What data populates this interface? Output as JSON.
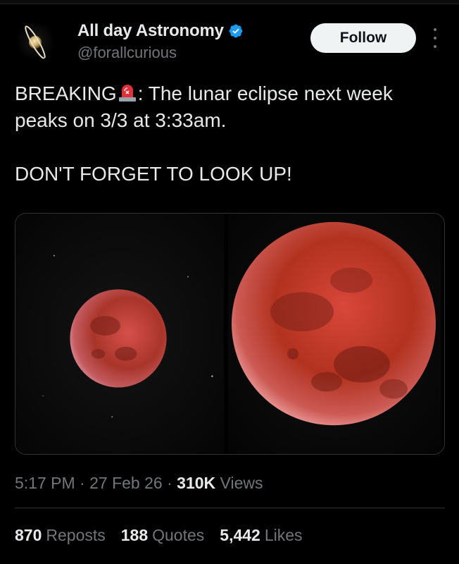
{
  "author": {
    "name": "All day Astronomy",
    "handle": "@forallcurious",
    "verified": true,
    "verified_color": "#1d9bf0"
  },
  "follow_label": "Follow",
  "tweet": {
    "line1_prefix": "BREAKING",
    "line1_emoji": "police-car-light-emoji",
    "line1_suffix": ": The lunar eclipse next week peaks on 3/3 at 3:33am.",
    "line2": "DON'T FORGET TO LOOK UP!"
  },
  "media": [
    {
      "name": "lunar-eclipse-photo-small",
      "color": "#b8372a"
    },
    {
      "name": "lunar-eclipse-photo-large",
      "color": "#a8291f"
    }
  ],
  "meta": {
    "time": "5:17 PM",
    "date": "27 Feb 26",
    "views_count": "310K",
    "views_label": "Views",
    "separator": "·"
  },
  "stats": {
    "reposts_count": "870",
    "reposts_label": "Reposts",
    "quotes_count": "188",
    "quotes_label": "Quotes",
    "likes_count": "5,442",
    "likes_label": "Likes"
  },
  "colors": {
    "background": "#000000",
    "text": "#e7e9ea",
    "muted": "#71767b",
    "follow_bg": "#eff3f4"
  }
}
